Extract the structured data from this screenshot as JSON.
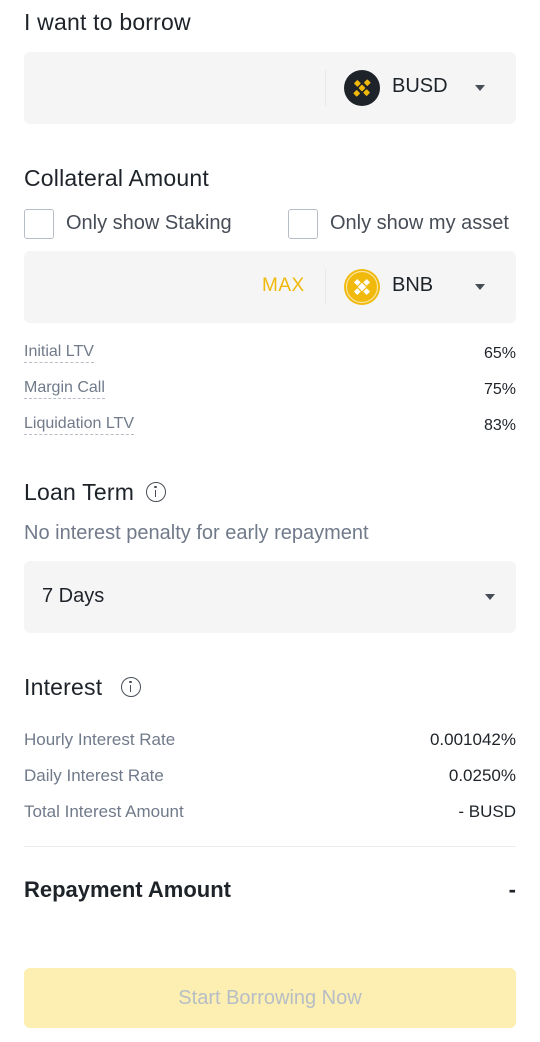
{
  "borrow": {
    "heading": "I want to borrow",
    "coin": {
      "symbol": "BUSD",
      "icon": "busd-coin-icon",
      "color": "#1e2329"
    }
  },
  "collateral": {
    "heading": "Collateral Amount",
    "checkboxes": [
      {
        "label": "Only show Staking",
        "checked": false
      },
      {
        "label": "Only show my asset",
        "checked": false
      }
    ],
    "max_label": "MAX",
    "coin": {
      "symbol": "BNB",
      "icon": "bnb-coin-icon",
      "color": "#f0b90b"
    }
  },
  "ltv": [
    {
      "label": "Initial LTV",
      "value": "65%"
    },
    {
      "label": "Margin Call",
      "value": "75%"
    },
    {
      "label": "Liquidation LTV",
      "value": "83%"
    }
  ],
  "loan_term": {
    "heading": "Loan Term",
    "subtitle": "No interest penalty for early repayment",
    "selected": "7 Days"
  },
  "interest": {
    "heading": "Interest",
    "rows": [
      {
        "label": "Hourly Interest Rate",
        "value": "0.001042%"
      },
      {
        "label": "Daily Interest Rate",
        "value": "0.0250%"
      },
      {
        "label": "Total Interest Amount",
        "value": "- BUSD"
      }
    ]
  },
  "repayment": {
    "label": "Repayment Amount",
    "value": "-"
  },
  "cta": {
    "label": "Start Borrowing Now",
    "enabled": false
  },
  "colors": {
    "accent": "#f0b90b",
    "cta_disabled_bg": "#fcefb1",
    "text_primary": "#1e2329",
    "text_secondary": "#707a8a"
  }
}
